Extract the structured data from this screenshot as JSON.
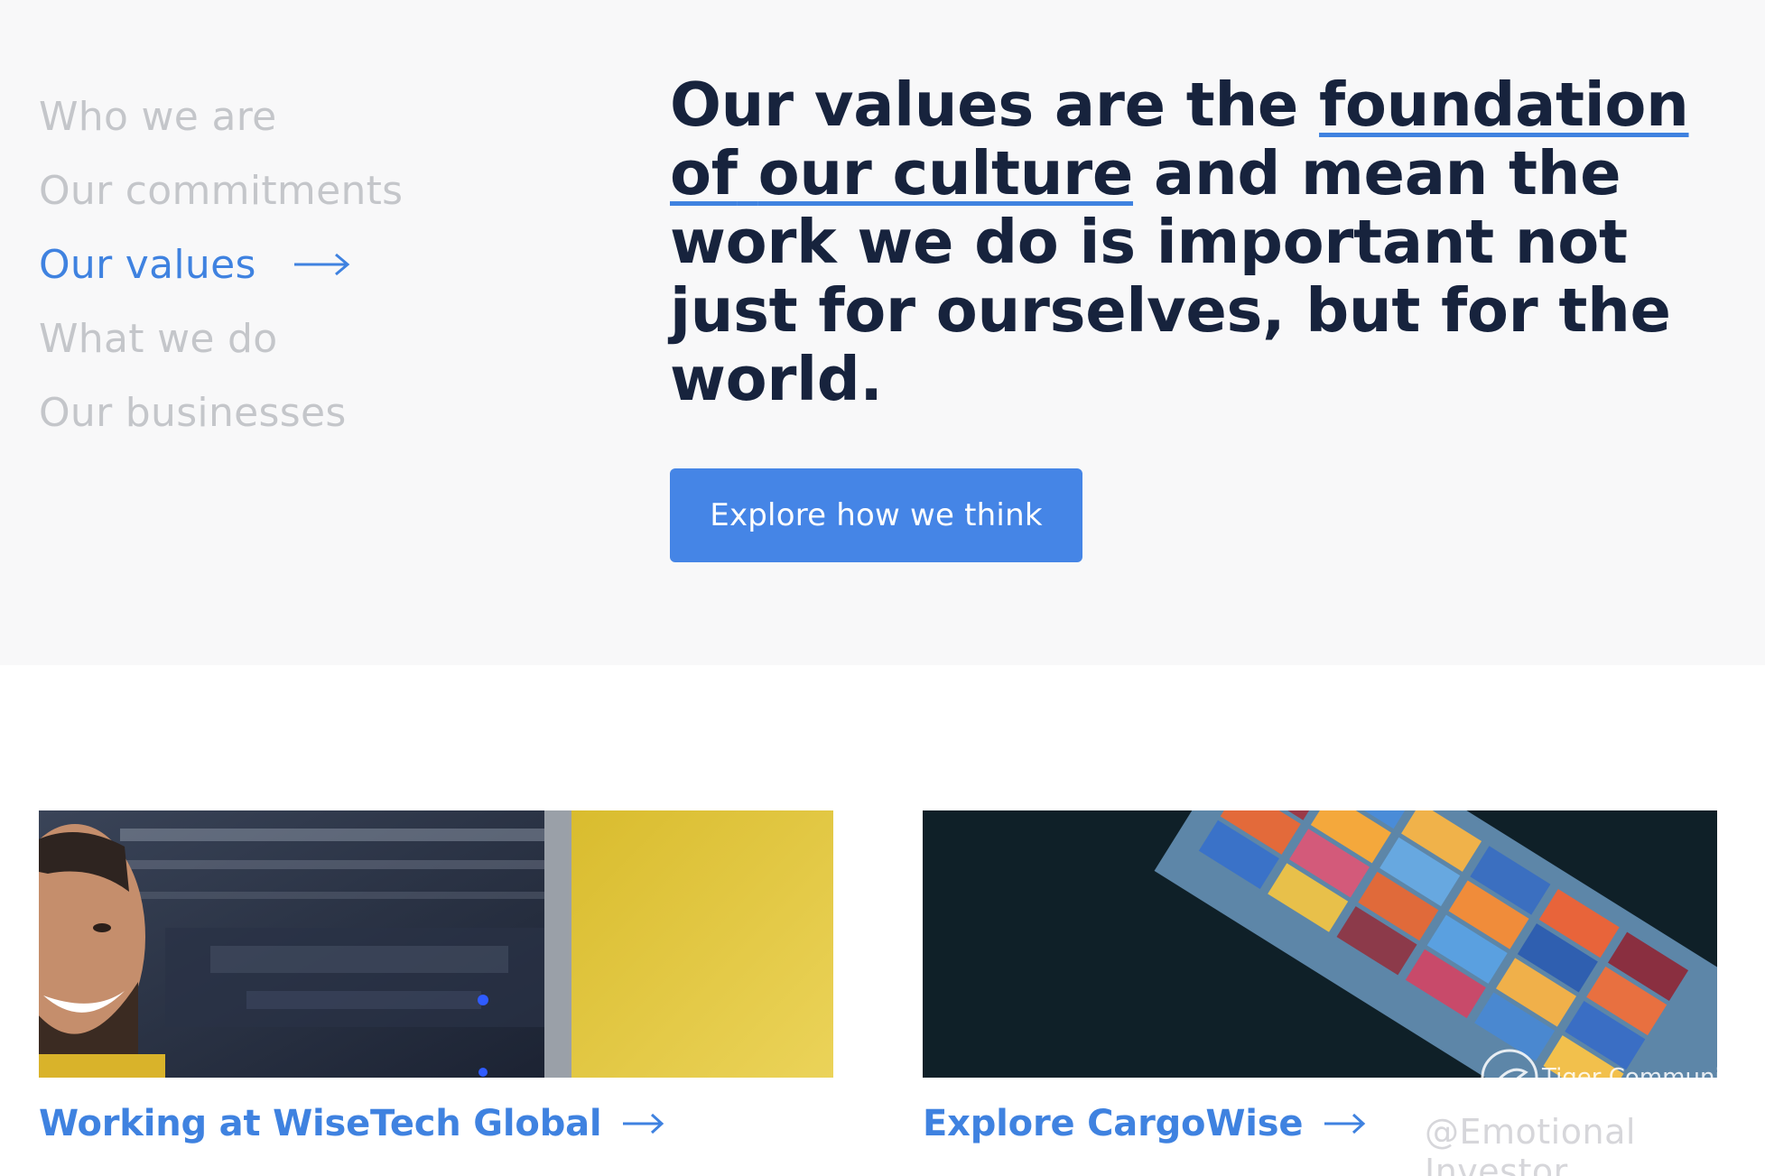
{
  "nav": {
    "items": [
      {
        "label": "Who we are",
        "active": false
      },
      {
        "label": "Our commitments",
        "active": false
      },
      {
        "label": "Our values",
        "active": true
      },
      {
        "label": "What we do",
        "active": false
      },
      {
        "label": "Our businesses",
        "active": false
      }
    ]
  },
  "headline": {
    "part1": "Our values are the ",
    "highlight1": "foundation of",
    "highlight2": "our culture",
    "part2": " and mean the work we do is important not just for ourselves, but for the world."
  },
  "cta": {
    "label": "Explore how we think"
  },
  "cards": [
    {
      "link_label": "Working at WiseTech Global"
    },
    {
      "link_label": "Explore CargoWise"
    }
  ],
  "watermark": {
    "community": "Tiger Community",
    "user": "@Emotional Investor"
  },
  "colors": {
    "accent": "#3f82e0",
    "button": "#4585e6",
    "heading": "#17233d",
    "nav_inactive": "#c4c6ca",
    "section_bg": "#f8f8f9"
  },
  "icons": {
    "nav_active": "arrow-right-icon",
    "card_link": "arrow-right-icon",
    "watermark": "tiger-logo-icon"
  }
}
